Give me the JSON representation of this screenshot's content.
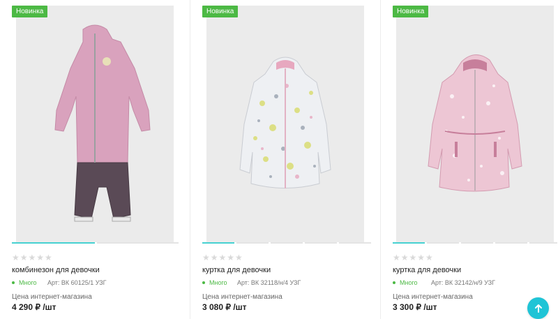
{
  "colors": {
    "accent": "#46d1d1",
    "badge": "#4cb944",
    "stock": "#4cb944",
    "scroll_button": "#1fc4d6"
  },
  "products": [
    {
      "badge": "Новинка",
      "image_icon": "pink-coverall-icon",
      "rating_stars": "★★★★★",
      "rating_value": 0,
      "name": "комбинезон для девочки",
      "stock": "Много",
      "sku": "Арт: ВК 60125/1 УЗГ",
      "price_label": "Цена интернет-магазина",
      "price": "4 290 ₽ /шт",
      "slides": 2,
      "active_slide": 0
    },
    {
      "badge": "Новинка",
      "image_icon": "floral-jacket-icon",
      "rating_stars": "★★★★★",
      "rating_value": 0,
      "name": "куртка для девочки",
      "stock": "Много",
      "sku": "Арт: ВК 32118/н/4 УЗГ",
      "price_label": "Цена интернет-магазина",
      "price": "3 080 ₽ /шт",
      "slides": 5,
      "active_slide": 0
    },
    {
      "badge": "Новинка",
      "image_icon": "pink-jacket-icon",
      "rating_stars": "★★★★★",
      "rating_value": 0,
      "name": "куртка для девочки",
      "stock": "Много",
      "sku": "Арт: ВК 32142/н/9 УЗГ",
      "price_label": "Цена интернет-магазина",
      "price": "3 300 ₽ /шт",
      "slides": 5,
      "active_slide": 0
    }
  ],
  "scroll_top": {
    "icon": "arrow-up-icon"
  }
}
